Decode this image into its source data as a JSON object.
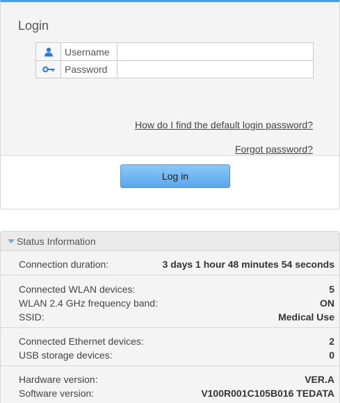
{
  "login": {
    "title": "Login",
    "username_label": "Username",
    "password_label": "Password",
    "username_value": "",
    "password_value": "",
    "default_password_link": "How do I find the default login password?",
    "forgot_password_link": "Forgot password?",
    "login_button": "Log in"
  },
  "status": {
    "header": "Status Information",
    "connection_duration": {
      "label": "Connection duration:",
      "value": "3 days 1 hour 48 minutes 54 seconds"
    },
    "wlan_devices": {
      "label": "Connected WLAN devices:",
      "value": "5"
    },
    "wlan_band": {
      "label": "WLAN 2.4 GHz frequency band:",
      "value": "ON"
    },
    "ssid": {
      "label": "SSID:",
      "value": "Medical Use"
    },
    "ethernet_devices": {
      "label": "Connected Ethernet devices:",
      "value": "2"
    },
    "usb_devices": {
      "label": "USB storage devices:",
      "value": "0"
    },
    "hardware_version": {
      "label": "Hardware version:",
      "value": "VER.A"
    },
    "software_version": {
      "label": "Software version:",
      "value": "V100R001C105B016 TEDATA"
    }
  },
  "colors": {
    "accent": "#4a9ee0",
    "button": "#6fb6f2",
    "icon": "#2f7bd0"
  },
  "icons": {
    "username": "user-icon",
    "password": "key-icon",
    "collapse": "triangle-down-icon"
  }
}
